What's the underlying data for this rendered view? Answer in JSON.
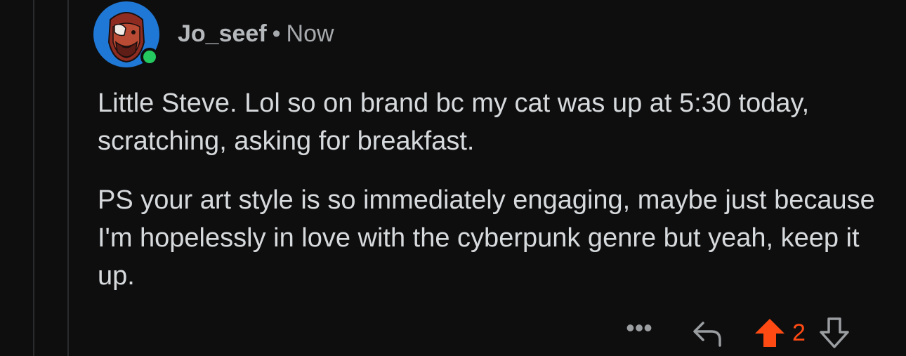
{
  "comment": {
    "username": "Jo_seef",
    "separator": "•",
    "timestamp": "Now",
    "paragraphs": [
      "Little Steve. Lol so on brand bc my cat was up at 5:30 today, scratching, asking for breakfast.",
      "PS your art style is so immediately engaging, maybe just because I'm hopelessly in love with the cyberpunk genre but yeah, keep it up."
    ],
    "online": true
  },
  "actions": {
    "more_label": "•••",
    "vote_count": "2",
    "upvoted": true
  },
  "colors": {
    "background": "#0e0e0f",
    "avatar_bg": "#1f78d6",
    "online": "#24c95f",
    "upvote_accent": "#ff4a13",
    "text": "#d7dadc",
    "muted": "#a7aaad"
  },
  "icons": {
    "avatar": "avatar-face-icon",
    "reply": "reply-arrow-icon",
    "upvote": "upvote-arrow-icon",
    "downvote": "downvote-arrow-icon",
    "more": "more-dots-icon"
  }
}
